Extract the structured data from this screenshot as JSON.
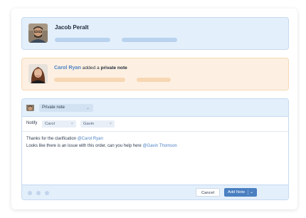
{
  "cards": {
    "jacob": {
      "name": "Jacob Peralt"
    },
    "carol": {
      "name": "Carol Ryan",
      "action_text": " added a ",
      "action_bold": "private note"
    }
  },
  "compose": {
    "note_type": "Private note",
    "notify_label": "Notify",
    "notify_chips": [
      "Carol",
      "Gavin"
    ],
    "body_line1": "Thanks for the clarification ",
    "body_line1_mention": "@Carol Ryan",
    "body_line2": "Looks like there is an issue with this order, can you help here ",
    "body_line2_mention": "@Gavin Thomson",
    "cancel_label": "Cancel",
    "add_note_label": "Add Note"
  },
  "colors": {
    "accent_blue": "#4a7fc1",
    "blue_card_bg": "#e3effb",
    "orange_card_bg": "#fdf0e2",
    "mention": "#4d83c4"
  },
  "icons": [
    "chevron-down-icon",
    "close-icon",
    "dot-icon"
  ]
}
